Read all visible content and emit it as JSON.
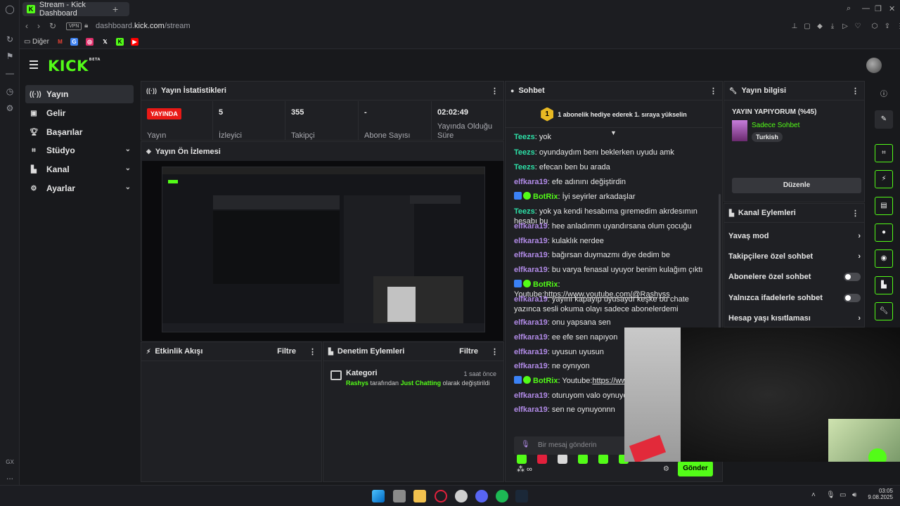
{
  "browser": {
    "tab_title": "Stream - Kick Dashboard",
    "vpn_label": "VPN",
    "url_prefix": "dashboard.",
    "url_domain": "kick.com",
    "url_path": "/stream",
    "bookmarks": [
      "Diğer"
    ],
    "rail_bottom": [
      "GX",
      "..."
    ]
  },
  "app": {
    "logo": "KICK",
    "logo_badge": "BETA",
    "nav": [
      {
        "label": "Yayın"
      },
      {
        "label": "Gelir"
      },
      {
        "label": "Başarılar"
      },
      {
        "label": "Stüdyo"
      },
      {
        "label": "Kanal"
      },
      {
        "label": "Ayarlar"
      }
    ]
  },
  "stats_panel": {
    "title": "Yayın İstatistikleri",
    "live_badge": "YAYINDA",
    "cells": [
      {
        "value": "",
        "label": "Yayın"
      },
      {
        "value": "5",
        "label": "İzleyici"
      },
      {
        "value": "355",
        "label": "Takipçi"
      },
      {
        "value": "-",
        "label": "Abone Sayısı"
      },
      {
        "value": "02:02:49",
        "label": "Yayında Olduğu Süre"
      }
    ]
  },
  "preview_panel": {
    "title": "Yayın Ön İzlemesi"
  },
  "activity_panel": {
    "title": "Etkinlik Akışı",
    "filter": "Filtre"
  },
  "moderation_panel": {
    "title": "Denetim Eylemleri",
    "filter": "Filtre",
    "entry": {
      "title": "Kategori",
      "time": "1 saat önce",
      "user": "Rashys",
      "mid": " tarafından ",
      "category": "Just Chatting",
      "tail": " olarak değiştirildi"
    }
  },
  "chat": {
    "title": "Sohbet",
    "pinned_rank": "1",
    "pinned": "1 abonelik hediye ederek 1. sıraya yükselin",
    "messages": [
      {
        "user": "Teezs",
        "text": ": yok",
        "color": "teal"
      },
      {
        "user": "Teezs",
        "text": ": oyundaydım benı beklerken uyudu amk",
        "color": "teal"
      },
      {
        "user": "Teezs",
        "text": ": efecan ben bu arada",
        "color": "teal"
      },
      {
        "user": "elfkara19",
        "text": ": efe adınını değiştirdin",
        "color": "purple"
      },
      {
        "user": "BotRix",
        "text": ": İyi seyirler arkadaşlar",
        "color": "green",
        "bot": true
      },
      {
        "user": "Teezs",
        "text": ": yok ya kendi hesabıma gıremedim akrdesımın hesabı bu",
        "color": "teal"
      },
      {
        "user": "elfkara19",
        "text": ": hee anladımm uyandırsana olum çocuğu",
        "color": "purple"
      },
      {
        "user": "elfkara19",
        "text": ": kulaklık nerdee",
        "color": "purple"
      },
      {
        "user": "elfkara19",
        "text": ": bağırsan duymazmı diye dedim be",
        "color": "purple"
      },
      {
        "user": "elfkara19",
        "text": ": bu varya fenasal uyuyor benim kulağım çıktı",
        "color": "purple"
      },
      {
        "user": "BotRix",
        "text": ": Youtube:",
        "link": "https://www.youtube.com/@Rashyss",
        "color": "green",
        "bot": true
      },
      {
        "user": "elfkara19",
        "text": ": yayını kapayıp uyusaydı keşke bu chate yazınca sesli okuma olayı sadece abonelerdemi",
        "color": "purple"
      },
      {
        "user": "elfkara19",
        "text": ": onu yapsana sen",
        "color": "purple"
      },
      {
        "user": "elfkara19",
        "text": ": ee efe sen napıyon",
        "color": "purple"
      },
      {
        "user": "elfkara19",
        "text": ": uyusun uyusun",
        "color": "purple"
      },
      {
        "user": "elfkara19",
        "text": ": ne oynıyon",
        "color": "purple"
      },
      {
        "user": "BotRix",
        "text": ": Youtube:",
        "link": "https://www.y",
        "color": "green",
        "bot": true
      },
      {
        "user": "elfkara19",
        "text": ": oturuyom valo oynuyordum",
        "color": "purple"
      },
      {
        "user": "elfkara19",
        "text": ": sen ne oynuyonnn",
        "color": "purple"
      }
    ],
    "input_placeholder": "Bir mesaj gönderin",
    "send": "Gönder"
  },
  "stream_info": {
    "title": "Yayın bilgisi",
    "stream_title": "YAYIN YAPIYORUM (%45)",
    "category_mode": "Sadece Sohbet",
    "language": "Turkish",
    "edit": "Düzenle"
  },
  "channel_actions": {
    "title": "Kanal Eylemleri",
    "items": [
      {
        "label": "Yavaş mod",
        "kind": "chevron"
      },
      {
        "label": "Takipçilere özel sohbet",
        "kind": "chevron"
      },
      {
        "label": "Abonelere özel sohbet",
        "kind": "toggle"
      },
      {
        "label": "Yalnızca ifadelerle sohbet",
        "kind": "toggle"
      },
      {
        "label": "Hesap yaşı kısıtlaması",
        "kind": "chevron"
      }
    ]
  },
  "taskbar": {
    "time": "03:05",
    "date": "9.08.2025"
  },
  "colors": {
    "brand": "#53fc18",
    "live": "#e91916",
    "panel": "#1f2024"
  }
}
